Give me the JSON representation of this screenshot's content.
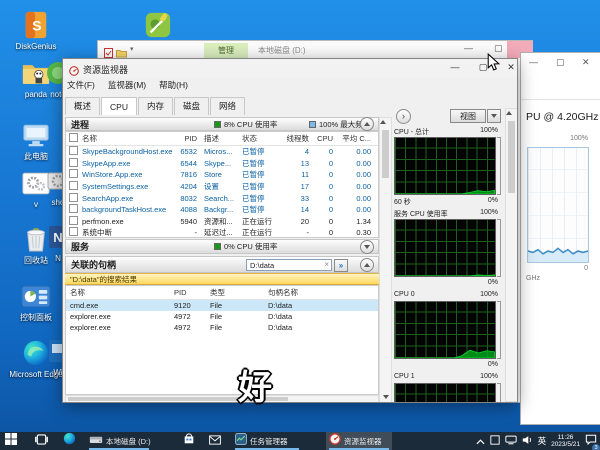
{
  "subtitle": "好",
  "desktop": {
    "icons": [
      {
        "name": "diskgenius",
        "label": "DiskGenius"
      },
      {
        "name": "notepad-plus-plus",
        "label": "Notepad++"
      },
      {
        "name": "panda-folder",
        "label": "panda"
      },
      {
        "name": "this-pc",
        "label": "此电脑"
      },
      {
        "name": "shortcut-v",
        "label": "v"
      },
      {
        "name": "recycle-bin",
        "label": "回收站"
      },
      {
        "name": "control-panel",
        "label": "控制面板"
      },
      {
        "name": "microsoft-edge",
        "label": "Microsoft Edge"
      },
      {
        "name": "hidden-note",
        "label": "note"
      },
      {
        "name": "hidden-sho",
        "label": "sho"
      },
      {
        "name": "hidden-n",
        "label": "N"
      },
      {
        "name": "hidden-wi",
        "label": "Wi"
      }
    ]
  },
  "explorer": {
    "manage_tab": "管理",
    "title": "本地磁盘 (D:)"
  },
  "taskman": {
    "cpu_label": "PU @ 4.20GHz",
    "top_label": "100%",
    "bottom_label": "0",
    "unit_label": "GHz",
    "usage_series": [
      8,
      7,
      9,
      6,
      8,
      7,
      10,
      7,
      9,
      6,
      8,
      7,
      8
    ]
  },
  "resmon": {
    "title": "资源监视器",
    "menu": [
      "文件(F)",
      "监视器(M)",
      "帮助(H)"
    ],
    "tabs": [
      "概述",
      "CPU",
      "内存",
      "磁盘",
      "网络"
    ],
    "active_tab": "CPU",
    "processes": {
      "title": "进程",
      "legend_cpu": "8% CPU 使用率",
      "legend_freq": "100% 最大频率",
      "columns": [
        "名称",
        "PID",
        "描述",
        "状态",
        "线程数",
        "CPU",
        "平均 C..."
      ],
      "rows": [
        {
          "name": "SkypeBackgroundHost.exe",
          "pid": "6532",
          "desc": "Micros...",
          "status": "已暂停",
          "threads": "4",
          "cpu": "0",
          "avg": "0.00",
          "suspended": true
        },
        {
          "name": "SkypeApp.exe",
          "pid": "6544",
          "desc": "Skype...",
          "status": "已暂停",
          "threads": "13",
          "cpu": "0",
          "avg": "0.00",
          "suspended": true
        },
        {
          "name": "WinStore.App.exe",
          "pid": "7816",
          "desc": "Store",
          "status": "已暂停",
          "threads": "11",
          "cpu": "0",
          "avg": "0.00",
          "suspended": true
        },
        {
          "name": "SystemSettings.exe",
          "pid": "4204",
          "desc": "设置",
          "status": "已暂停",
          "threads": "17",
          "cpu": "0",
          "avg": "0.00",
          "suspended": true
        },
        {
          "name": "SearchApp.exe",
          "pid": "8032",
          "desc": "Search...",
          "status": "已暂停",
          "threads": "33",
          "cpu": "0",
          "avg": "0.00",
          "suspended": true
        },
        {
          "name": "backgroundTaskHost.exe",
          "pid": "4088",
          "desc": "Backgr...",
          "status": "已暂停",
          "threads": "14",
          "cpu": "0",
          "avg": "0.00",
          "suspended": true
        },
        {
          "name": "perfmon.exe",
          "pid": "5940",
          "desc": "资源和...",
          "status": "正在运行",
          "threads": "20",
          "cpu": "0",
          "avg": "1.34",
          "suspended": false
        },
        {
          "name": "系统中断",
          "pid": "-",
          "desc": "延迟过...",
          "status": "正在运行",
          "threads": "-",
          "cpu": "0",
          "avg": "0.30",
          "suspended": false
        }
      ]
    },
    "services": {
      "title": "服务",
      "legend_cpu": "0% CPU 使用率"
    },
    "handles": {
      "title": "关联的句柄",
      "search_value": "D:\\data",
      "result_banner": "\"D:\\data\"的搜索结果",
      "columns": [
        "名称",
        "PID",
        "类型",
        "句柄名称"
      ],
      "rows": [
        {
          "name": "cmd.exe",
          "pid": "9120",
          "type": "File",
          "handle": "D:\\data",
          "selected": true
        },
        {
          "name": "explorer.exe",
          "pid": "4972",
          "type": "File",
          "handle": "D:\\data",
          "selected": false
        },
        {
          "name": "explorer.exe",
          "pid": "4972",
          "type": "File",
          "handle": "D:\\data",
          "selected": false
        }
      ]
    },
    "view_button": "视图",
    "graphs": [
      {
        "title": "CPU - 总计",
        "max_label": "100%",
        "bottom_left": "60 秒",
        "bottom_right": "0%",
        "series": [
          0,
          0,
          0,
          0,
          0,
          0,
          0,
          0,
          0,
          3,
          6,
          4,
          7
        ]
      },
      {
        "title": "服务 CPU 使用率",
        "max_label": "100%",
        "bottom_left": "",
        "bottom_right": "0%",
        "series": [
          0,
          0,
          0,
          0,
          0,
          0,
          0,
          0,
          0,
          0,
          2,
          1,
          2
        ]
      },
      {
        "title": "CPU 0",
        "max_label": "100%",
        "bottom_left": "",
        "bottom_right": "0%",
        "series": [
          0,
          0,
          0,
          0,
          0,
          0,
          0,
          0,
          4,
          14,
          9,
          13,
          11
        ]
      },
      {
        "title": "CPU 1",
        "max_label": "100%",
        "bottom_left": "",
        "bottom_right": "",
        "series": [
          0,
          0,
          0,
          0,
          0,
          0,
          0,
          0,
          0,
          0,
          0,
          0,
          0
        ]
      }
    ],
    "colors": {
      "graph_green": "#00a31d",
      "legend_green": "#169a16",
      "legend_blue": "#7cb9e8",
      "link_blue": "#0b61a4",
      "selection": "#cbe7f8"
    }
  },
  "taskbar": {
    "apps": [
      {
        "name": "start-button",
        "label": ""
      },
      {
        "name": "task-view-button",
        "label": ""
      },
      {
        "name": "edge",
        "label": ""
      },
      {
        "name": "local-disk-d",
        "label": "本地磁盘 (D:)"
      },
      {
        "name": "store",
        "label": ""
      },
      {
        "name": "mail",
        "label": ""
      },
      {
        "name": "task-manager",
        "label": "任务管理器"
      },
      {
        "name": "resource-monitor",
        "label": "资源监视器",
        "active": true
      }
    ],
    "tray": {
      "lang": "英",
      "time": "11:26",
      "date": "2023/5/21",
      "badge": "3"
    }
  }
}
